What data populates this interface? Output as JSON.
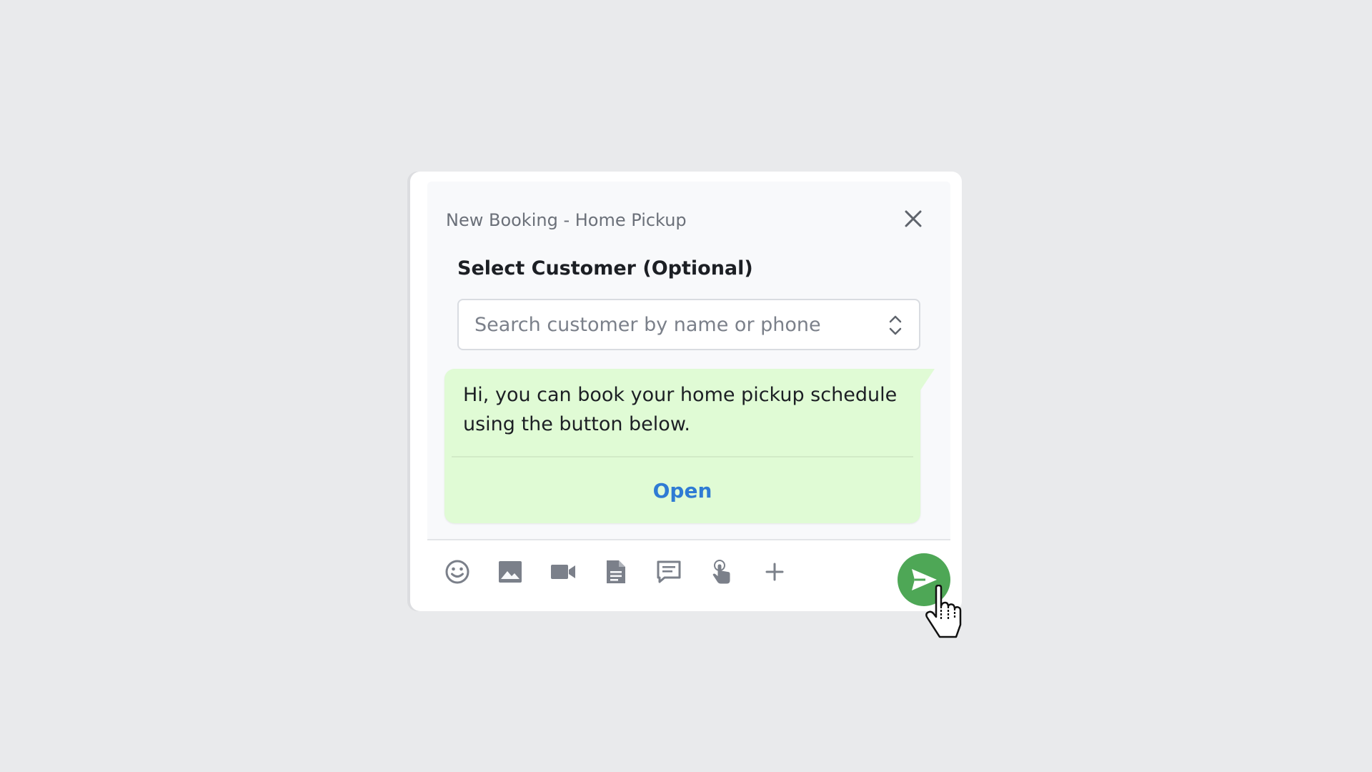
{
  "dialog": {
    "title": "New Booking - Home Pickup",
    "close_icon": "close-icon"
  },
  "customer_select": {
    "label": "Select Customer (Optional)",
    "placeholder": "Search customer by name or phone",
    "value": "",
    "icon": "chevron-up-down-icon"
  },
  "message": {
    "text": "Hi, you can book your home pickup schedule using the button below.",
    "action_label": "Open",
    "bubble_color": "#e0fbd5",
    "action_color": "#2f7bd4"
  },
  "toolbar": {
    "icons": [
      "emoji-icon",
      "image-icon",
      "video-icon",
      "document-icon",
      "chat-icon",
      "touch-icon",
      "plus-icon"
    ],
    "send_icon": "send-icon",
    "send_color": "#4ea756"
  }
}
